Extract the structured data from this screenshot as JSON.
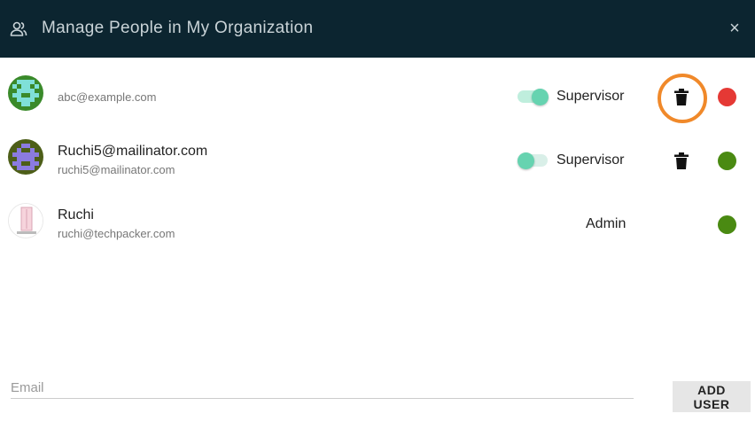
{
  "header": {
    "title": "Manage People in My Organization",
    "icon": "people-icon",
    "close_label": "×"
  },
  "users": [
    {
      "name": "",
      "email": "abc@example.com",
      "role": "Supervisor",
      "toggle_on": true,
      "can_delete": true,
      "status_color": "#e53935"
    },
    {
      "name": "Ruchi5@mailinator.com",
      "email": "ruchi5@mailinator.com",
      "role": "Supervisor",
      "toggle_on": false,
      "can_delete": true,
      "status_color": "#4a8a12"
    },
    {
      "name": "Ruchi",
      "email": "ruchi@techpacker.com",
      "role": "Admin",
      "toggle_on": null,
      "can_delete": false,
      "status_color": "#4a8a12"
    }
  ],
  "add_user": {
    "placeholder": "Email",
    "value": "",
    "button_label": "ADD USER"
  },
  "colors": {
    "header_bg": "#0c2530",
    "toggle_knob": "#66d3b0",
    "toggle_track": "#bfeedd",
    "highlight": "#f0892a"
  }
}
